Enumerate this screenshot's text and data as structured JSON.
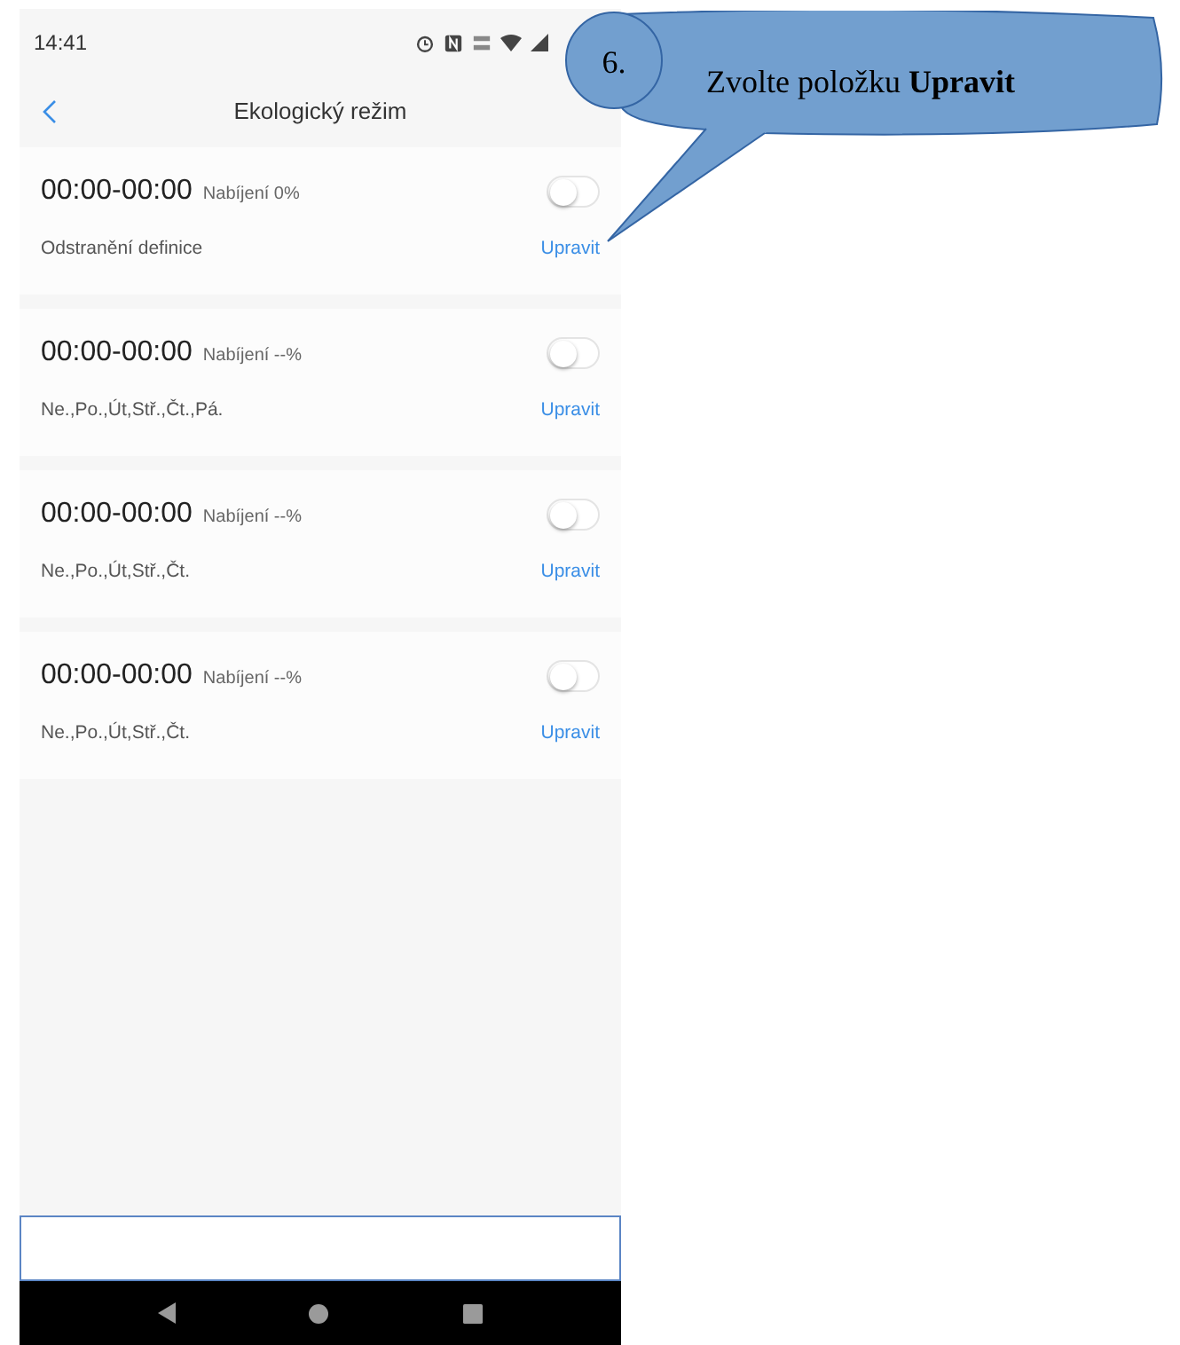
{
  "status_bar": {
    "time": "14:41"
  },
  "header": {
    "title": "Ekologický režim"
  },
  "schedules": [
    {
      "time": "00:00-00:00",
      "charge": "Nabíjení 0%",
      "days": "Odstranění definice",
      "edit": "Upravit",
      "on": false
    },
    {
      "time": "00:00-00:00",
      "charge": "Nabíjení --%",
      "days": "Ne.,Po.,Út,Stř.,Čt.,Pá.",
      "edit": "Upravit",
      "on": false
    },
    {
      "time": "00:00-00:00",
      "charge": "Nabíjení --%",
      "days": "Ne.,Po.,Út,Stř.,Čt.",
      "edit": "Upravit",
      "on": false
    },
    {
      "time": "00:00-00:00",
      "charge": "Nabíjení --%",
      "days": "Ne.,Po.,Út,Stř.,Čt.",
      "edit": "Upravit",
      "on": false
    }
  ],
  "callout": {
    "step": "6.",
    "text": "Zvolte položku **Upravit**"
  }
}
